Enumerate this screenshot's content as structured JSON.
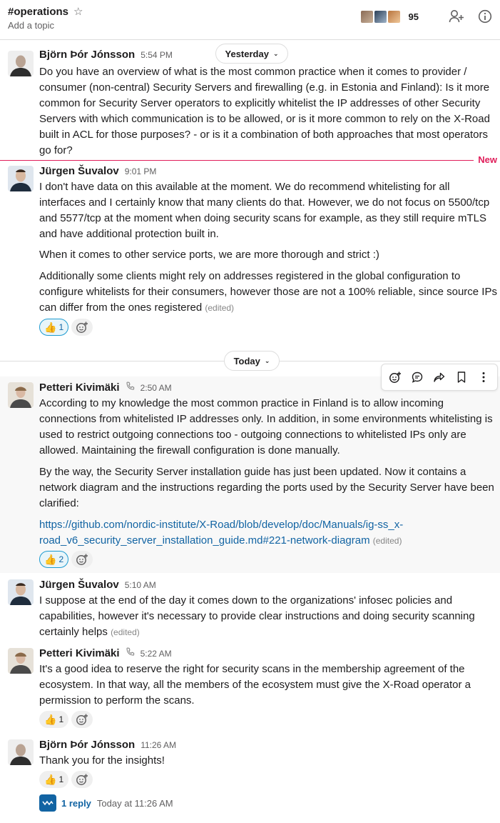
{
  "channel": {
    "name": "#operations",
    "topic_placeholder": "Add a topic",
    "member_count": "95"
  },
  "dividers": {
    "yesterday": "Yesterday",
    "today": "Today",
    "new_label": "New"
  },
  "messages": [
    {
      "author": "Björn Þór Jónsson",
      "time": "5:54 PM",
      "text": "Do you have an overview of what is the most common practice when it comes to provider / consumer (non-central) Security Servers and firewalling (e.g. in Estonia and Finland):  Is it more common for Security Server operators to explicitly whitelist the IP addresses of other Security Servers with which communication is to be allowed, or is it more common to rely on the X-Road built in ACL for those purposes?  - or is it a combination of both approaches that most operators go for?"
    },
    {
      "author": "Jürgen Šuvalov",
      "time": "9:01 PM",
      "paragraphs": [
        "I don't have data on this available at the moment. We do recommend whitelisting for all interfaces and I certainly know that many clients do that. However, we do not focus on 5500/tcp and 5577/tcp at the moment when doing security scans for example, as they still require mTLS and have additional protection built in.",
        "When it comes to other service ports, we are more thorough and strict :)",
        "Additionally some clients might rely on addresses registered in the global configuration to configure whitelists for their consumers, however those are not a 100% reliable, since source IPs can differ from the ones registered"
      ],
      "edited": "(edited)",
      "reaction_count": "1"
    },
    {
      "author": "Petteri Kivimäki",
      "time": "2:50 AM",
      "paragraphs": [
        "According to my knowledge the most common practice in Finland is to allow incoming connections from whitelisted IP addresses only. In addition, in some environments whitelisting is used to restrict outgoing connections too - outgoing connections to whitelisted IPs only are allowed. Maintaining the firewall configuration is done manually.",
        "By the way, the Security Server installation guide has just been updated. Now it contains a network diagram and the instructions regarding the ports used by the Security Server have been clarified:"
      ],
      "link_line1": "https://github.com/nordic-institute/X-Road/blob/develop/doc/Manuals/ig-ss_x-",
      "link_line2": "road_v6_security_server_installation_guide.md#221-network-diagram",
      "edited": "(edited)",
      "reaction_count": "2"
    },
    {
      "author": "Jürgen Šuvalov",
      "time": "5:10 AM",
      "text": "I suppose at the end of the day it comes down to the organizations' infosec policies and capabilities, however it's necessary to provide clear instructions and doing security scanning certainly helps",
      "edited": "(edited)"
    },
    {
      "author": "Petteri Kivimäki",
      "time": "5:22 AM",
      "text": "It's a good idea to reserve the right for security scans in the membership agreement of the ecosystem. In that way, all the members of the ecosystem must give the X-Road operator a permission to perform the scans.",
      "reaction_count": "1"
    },
    {
      "author": "Björn Þór Jónsson",
      "time": "11:26 AM",
      "text": "Thank you for the insights!",
      "reaction_count": "1",
      "thread_replies": "1 reply",
      "thread_time": "Today at 11:26 AM"
    }
  ],
  "colors": {
    "link": "#1264a3",
    "new_divider": "#e01e5a",
    "reaction_mine_border": "#1d9bd1"
  }
}
